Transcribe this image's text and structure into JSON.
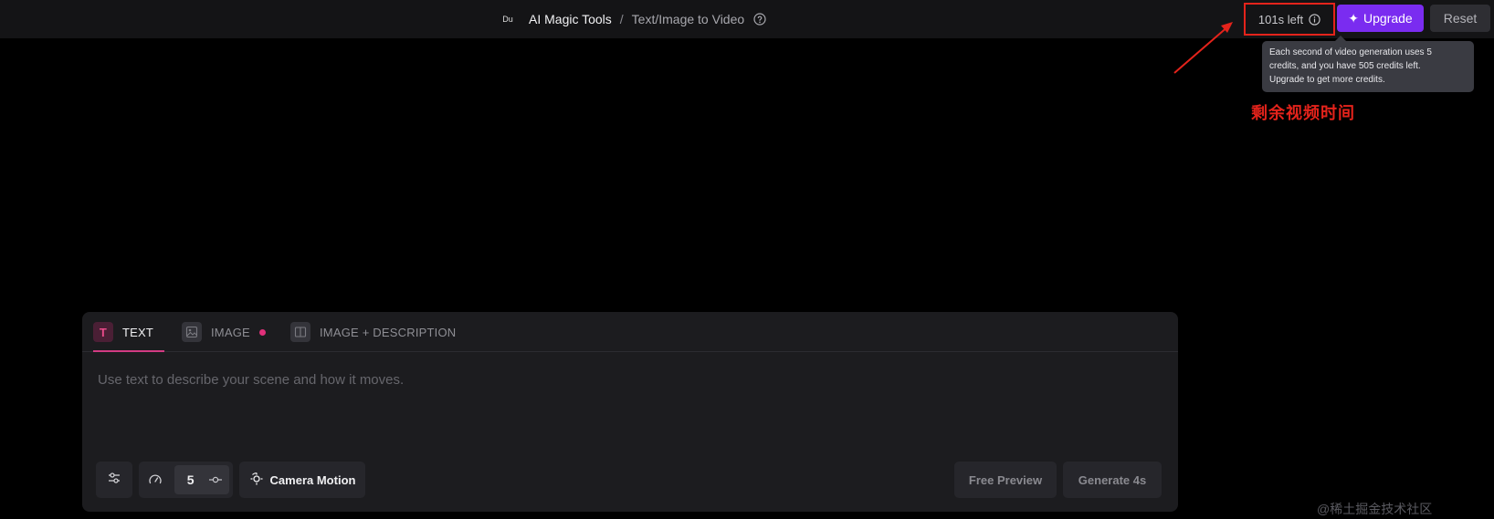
{
  "header": {
    "logo_text": "Du",
    "breadcrumb_root": "AI Magic Tools",
    "breadcrumb_sep": "/",
    "breadcrumb_page": "Text/Image to Video",
    "credits_label": "101s left",
    "upgrade_label": "Upgrade",
    "reset_label": "Reset"
  },
  "tooltip": {
    "line1": "Each second of video generation uses 5",
    "line2": "credits, and you have 505 credits left.",
    "line3": "Upgrade to get more credits."
  },
  "annotation": {
    "label": "剩余视频时间",
    "color": "#e4231b"
  },
  "tabs": [
    {
      "label": "TEXT",
      "icon": "text-T-icon",
      "active": true
    },
    {
      "label": "IMAGE",
      "icon": "image-icon",
      "active": false,
      "badge": "dot"
    },
    {
      "label": "IMAGE + DESCRIPTION",
      "icon": "split-layout-icon",
      "active": false
    }
  ],
  "prompt": {
    "placeholder": "Use text to describe your scene and how it moves.",
    "value": ""
  },
  "controls": {
    "speed_value": "5",
    "camera_label": "Camera Motion",
    "free_preview_label": "Free Preview",
    "generate_label": "Generate 4s"
  },
  "watermark": "@稀土掘金技术社区",
  "colors": {
    "accent": "#7a2cf0",
    "tab_active": "#d23b82",
    "highlight_box": "#e4231b"
  }
}
